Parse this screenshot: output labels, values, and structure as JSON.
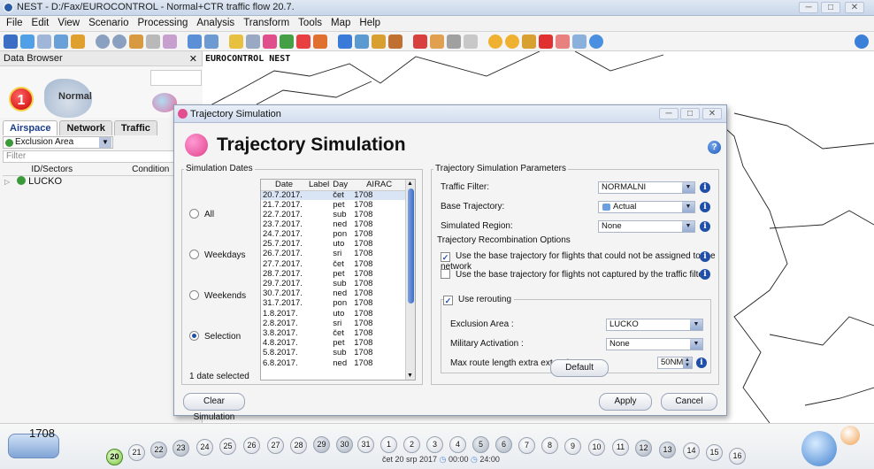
{
  "window": {
    "title": "NEST - D:/Fax/EUROCONTROL - Normal+CTR traffic flow 20.7."
  },
  "menu": [
    "File",
    "Edit",
    "View",
    "Scenario",
    "Processing",
    "Analysis",
    "Transform",
    "Tools",
    "Map",
    "Help"
  ],
  "browser": {
    "title": "Data Browser",
    "close": "✕",
    "scenario_number": "1",
    "scenario_name": "Normal",
    "tabs": [
      "Airspace",
      "Network",
      "Traffic"
    ],
    "active_tab": "Airspace",
    "selector": "Exclusion Area",
    "filter_placeholder": "Filter",
    "columns": [
      "ID/Sectors",
      "Condition"
    ],
    "tree_item": "LUCKO"
  },
  "map": {
    "label": "EUROCONTROL NEST"
  },
  "dialog": {
    "window_title": "Trajectory Simulation",
    "heading": "Trajectory Simulation",
    "dates_group": "Simulation Dates",
    "radios": [
      {
        "label": "All",
        "selected": false
      },
      {
        "label": "Weekdays",
        "selected": false
      },
      {
        "label": "Weekends",
        "selected": false
      },
      {
        "label": "Selection",
        "selected": true
      }
    ],
    "selected_count": "1 date selected",
    "table_headers": [
      "Date",
      "Label",
      "Day",
      "AIRAC"
    ],
    "rows": [
      [
        "20.7.2017.",
        "",
        "čet",
        "1708"
      ],
      [
        "21.7.2017.",
        "",
        "pet",
        "1708"
      ],
      [
        "22.7.2017.",
        "",
        "sub",
        "1708"
      ],
      [
        "23.7.2017.",
        "",
        "ned",
        "1708"
      ],
      [
        "24.7.2017.",
        "",
        "pon",
        "1708"
      ],
      [
        "25.7.2017.",
        "",
        "uto",
        "1708"
      ],
      [
        "26.7.2017.",
        "",
        "sri",
        "1708"
      ],
      [
        "27.7.2017.",
        "",
        "čet",
        "1708"
      ],
      [
        "28.7.2017.",
        "",
        "pet",
        "1708"
      ],
      [
        "29.7.2017.",
        "",
        "sub",
        "1708"
      ],
      [
        "30.7.2017.",
        "",
        "ned",
        "1708"
      ],
      [
        "31.7.2017.",
        "",
        "pon",
        "1708"
      ],
      [
        "1.8.2017.",
        "",
        "uto",
        "1708"
      ],
      [
        "2.8.2017.",
        "",
        "sri",
        "1708"
      ],
      [
        "3.8.2017.",
        "",
        "čet",
        "1708"
      ],
      [
        "4.8.2017.",
        "",
        "pet",
        "1708"
      ],
      [
        "5.8.2017.",
        "",
        "sub",
        "1708"
      ],
      [
        "6.8.2017.",
        "",
        "ned",
        "1708"
      ]
    ],
    "params_group": "Trajectory Simulation Parameters",
    "traffic_filter_label": "Traffic Filter:",
    "traffic_filter_value": "NORMALNI",
    "base_traj_label": "Base Trajectory:",
    "base_traj_value": "Actual",
    "sim_region_label": "Simulated Region:",
    "sim_region_value": "None",
    "recomb_label": "Trajectory Recombination Options",
    "check_network": {
      "label": "Use the base trajectory for flights that could not be assigned to the network",
      "checked": true
    },
    "check_filter": {
      "label": "Use the base trajectory for flights not captured by the traffic filter",
      "checked": false
    },
    "rerouting": {
      "label": "Use rerouting",
      "checked": true
    },
    "excl_label": "Exclusion Area :",
    "excl_value": "LUCKO",
    "mil_label": "Military Activation :",
    "mil_value": "None",
    "max_label": "Max route length extra extension:",
    "max_value": "50NM",
    "default_btn": "Default",
    "clear_btn": "Clear Simulation",
    "apply_btn": "Apply",
    "cancel_btn": "Cancel"
  },
  "timeline": {
    "year": "1708",
    "date_text": "čet 20 srp 2017",
    "time_from": "00:00",
    "time_to": "24:00",
    "days": [
      "20",
      "21",
      "22",
      "23",
      "24",
      "25",
      "26",
      "27",
      "28",
      "29",
      "30",
      "31",
      "1",
      "2",
      "3",
      "4",
      "5",
      "6",
      "7",
      "8",
      "9",
      "10",
      "11",
      "12",
      "13",
      "14",
      "15",
      "16"
    ],
    "weekend_days": [
      "22",
      "23",
      "29",
      "30",
      "5",
      "6",
      "12",
      "13"
    ]
  }
}
